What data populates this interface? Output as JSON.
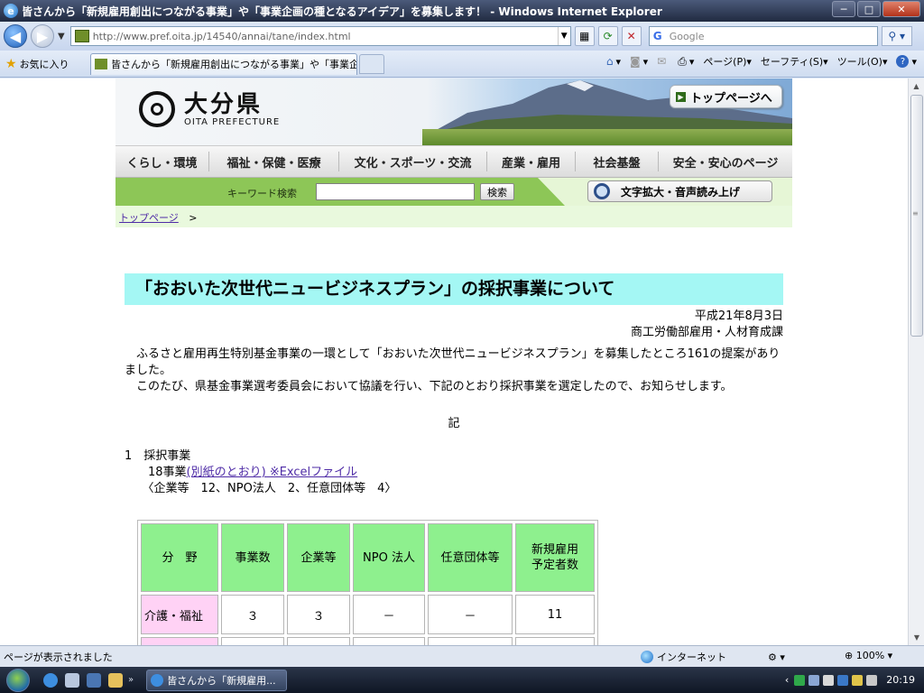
{
  "window": {
    "title": "皆さんから「新規雇用創出につながる事業」や「事業企画の種となるアイデア」を募集します！ - Windows Internet Explorer",
    "controls": {
      "minimize": "─",
      "maximize": "□",
      "close": "✕"
    }
  },
  "addressbar": {
    "url": "http://www.pref.oita.jp/14540/annai/tane/index.html",
    "search_placeholder": "Google"
  },
  "tabbar": {
    "favorites_label": "お気に入り",
    "tab_title": "皆さんから「新規雇用創出につながる事業」や「事業企...",
    "commands": {
      "page": "ページ(P)",
      "safety": "セーフティ(S)",
      "tools": "ツール(O)"
    }
  },
  "site": {
    "logo_jp": "大分県",
    "logo_en": "OITA PREFECTURE",
    "top_button": "トップページへ",
    "nav": [
      "くらし・環境",
      "福祉・保健・医療",
      "文化・スポーツ・交流",
      "産業・雇用",
      "社会基盤",
      "安全・安心のページ"
    ],
    "keyword_label": "キーワード検索",
    "search_button": "検索",
    "accessibility_button": "文字拡大・音声読み上げ",
    "breadcrumb_link": "トップページ",
    "breadcrumb_sep": ">"
  },
  "article": {
    "title": "「おおいた次世代ニュービジネスプラン」の採択事業について",
    "date": "平成21年8月3日",
    "dept": "商工労働部雇用・人材育成課",
    "para1": "　ふるさと雇用再生特別基金事業の一環として「おおいた次世代ニュービジネスプラン」を募集したところ161の提案がありました。",
    "para2": "　このたび、県基金事業選考委員会において協議を行い、下記のとおり採択事業を選定したので、お知らせします。",
    "ki": "記",
    "section1": "1　採択事業",
    "count_prefix": "　　18事業",
    "count_link": "(別紙のとおり) ※Excelファイル",
    "breakdown": "　　〈企業等　12、NPO法人　2、任意団体等　4〉"
  },
  "table": {
    "headers": [
      "分　野",
      "事業数",
      "企業等",
      "NPO 法人",
      "任意団体等",
      "新規雇用\n予定者数"
    ],
    "rows": [
      [
        "介護・福祉",
        "３",
        "３",
        "－",
        "－",
        "11"
      ],
      [
        "",
        "",
        "",
        "",
        "",
        ""
      ]
    ]
  },
  "statusbar": {
    "message": "ページが表示されました",
    "zone": "インターネット",
    "zoom": "100%"
  },
  "taskbar": {
    "item": "皆さんから「新規雇用...",
    "clock": "20:19"
  }
}
